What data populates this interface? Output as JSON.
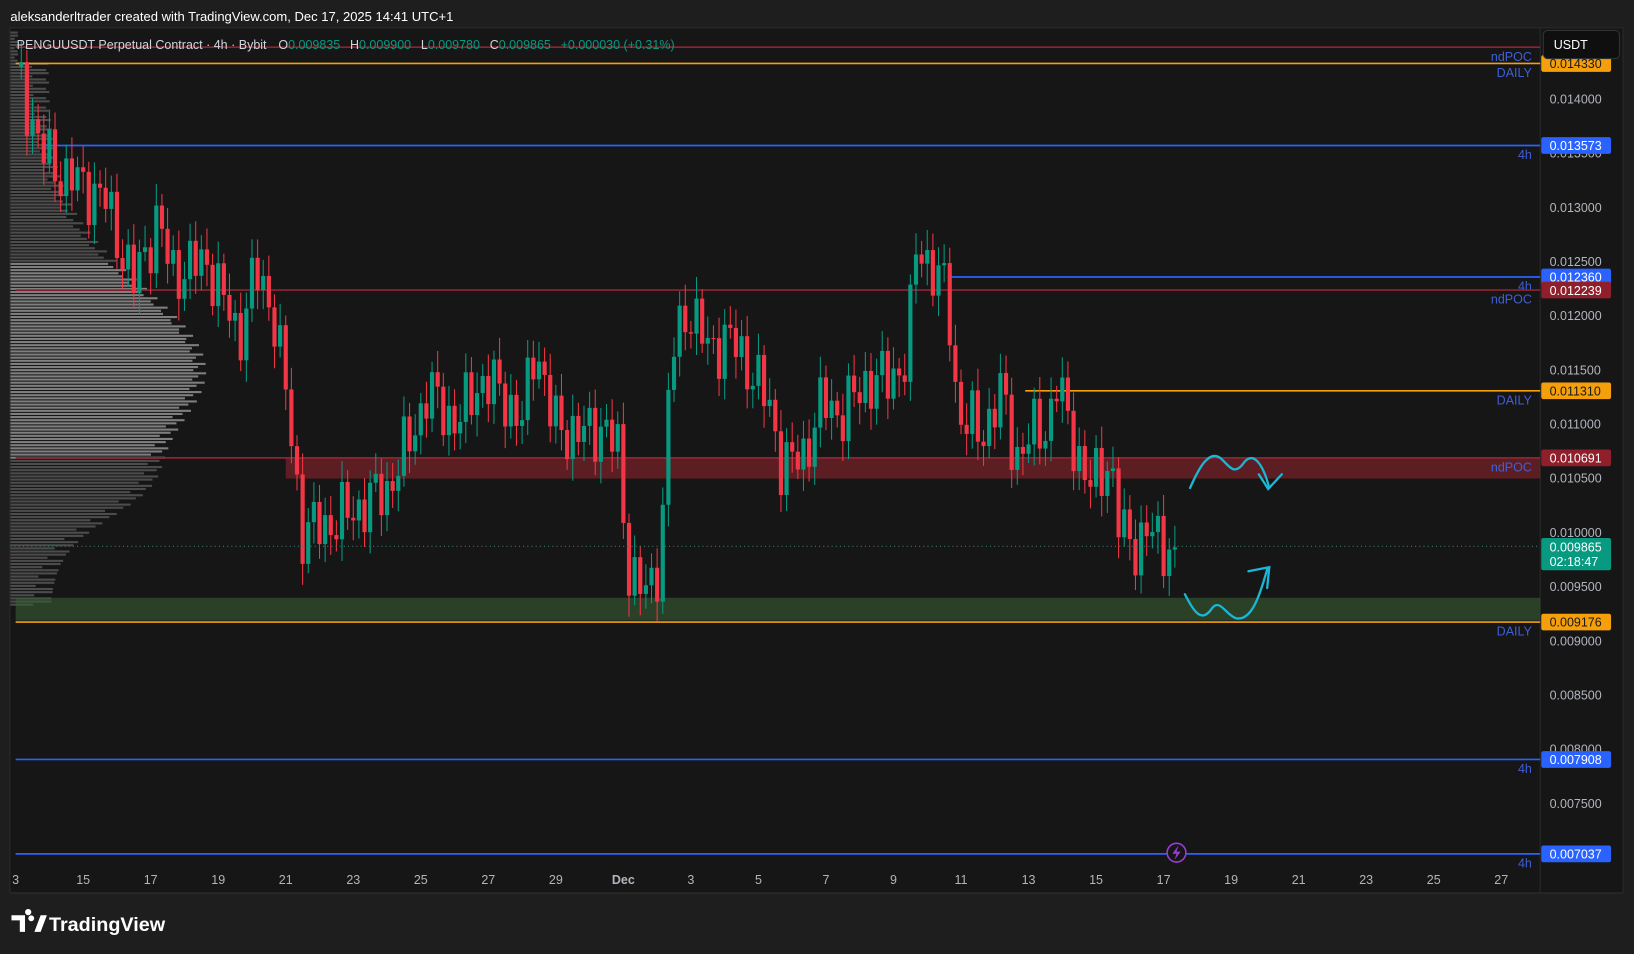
{
  "header": {
    "attribution": "aleksanderltrader created with TradingView.com, Dec 17, 2025 14:41 UTC+1",
    "symbol": "PENGUUSDT Perpetual Contract · 4h · Bybit",
    "o_label": "O",
    "o": "0.009835",
    "h_label": "H",
    "h": "0.009900",
    "l_label": "L",
    "l": "0.009780",
    "c_label": "C",
    "c": "0.009865",
    "change": "+0.000030 (+0.31%)"
  },
  "currency_button": "USDT",
  "price_axis_ticks": [
    "0.014000",
    "0.013500",
    "0.013000",
    "0.012500",
    "0.012000",
    "0.011500",
    "0.011000",
    "0.010500",
    "0.010000",
    "0.009500",
    "0.009000",
    "0.008500",
    "0.008000",
    "0.007500"
  ],
  "time_axis_ticks": [
    "3",
    "15",
    "17",
    "19",
    "21",
    "23",
    "25",
    "27",
    "29",
    "Dec",
    "3",
    "5",
    "7",
    "9",
    "11",
    "13",
    "15",
    "17",
    "19",
    "21",
    "23",
    "25",
    "27"
  ],
  "levels": [
    {
      "price": 0.01448,
      "color": "#8e2431",
      "label": "ndPOC",
      "tag": null,
      "start_day": 0
    },
    {
      "price": 0.01433,
      "color": "#f59f0b",
      "label": "DAILY",
      "tag": "0.014330",
      "start_day": 0
    },
    {
      "price": 0.013573,
      "color": "#2962ff",
      "label": "4h",
      "tag": "0.013573",
      "start_day": 0.8
    },
    {
      "price": 0.01236,
      "color": "#2962ff",
      "label": "4h",
      "tag": "0.012360",
      "start_day": 27.6
    },
    {
      "price": 0.012239,
      "color": "#8e2431",
      "label": "ndPOC",
      "tag": "0.012239",
      "start_day": 0
    },
    {
      "price": 0.01131,
      "color": "#f59f0b",
      "label": "DAILY",
      "tag": "0.011310",
      "start_day": 29.9
    },
    {
      "price": 0.010691,
      "color": "#8e2431",
      "label": "ndPOC",
      "tag": "0.010691",
      "start_day": 0
    },
    {
      "price": 0.009176,
      "color": "#f59f0b",
      "label": "DAILY",
      "tag": "0.009176",
      "start_day": 0
    },
    {
      "price": 0.007908,
      "color": "#2962ff",
      "label": "4h",
      "tag": "0.007908",
      "start_day": 0
    },
    {
      "price": 0.007037,
      "color": "#2962ff",
      "label": "4h",
      "tag": "0.007037",
      "start_day": 0
    }
  ],
  "zones": [
    {
      "name": "ndpoc-zone",
      "top": 0.010691,
      "bottom": 0.0105,
      "color": "rgba(178,40,51,0.45)",
      "start_day": 8.0
    },
    {
      "name": "demand-zone",
      "top": 0.0094,
      "bottom": 0.00919,
      "color": "rgba(56,95,52,0.6)",
      "start_day": 0
    }
  ],
  "current_price": {
    "value": "0.009865",
    "countdown": "02:18:47",
    "color": "#089981"
  },
  "colors": {
    "up": "#089981",
    "down": "#f23645",
    "annotation": "#1ab8d6"
  },
  "chart_data": {
    "type": "candlestick",
    "title": "PENGUUSDT Perpetual Contract · 4h · Bybit",
    "x_unit": "days since Nov 13, 2025",
    "ylim": [
      0.0069,
      0.0148
    ],
    "price_path": [
      [
        0,
        0.0143
      ],
      [
        0.8,
        0.0135
      ],
      [
        1.4,
        0.0133
      ],
      [
        2.6,
        0.0131
      ],
      [
        3.5,
        0.0123
      ],
      [
        4.2,
        0.0129
      ],
      [
        4.6,
        0.0124
      ],
      [
        5.7,
        0.0125
      ],
      [
        6.6,
        0.0118
      ],
      [
        7.1,
        0.0124
      ],
      [
        7.6,
        0.0121
      ],
      [
        8.0,
        0.0113
      ],
      [
        8.5,
        0.01
      ],
      [
        9.4,
        0.0101
      ],
      [
        10.0,
        0.0102
      ],
      [
        11.0,
        0.0104
      ],
      [
        11.6,
        0.0108
      ],
      [
        12.2,
        0.0113
      ],
      [
        13.1,
        0.011
      ],
      [
        13.7,
        0.0114
      ],
      [
        14.4,
        0.0113
      ],
      [
        15.0,
        0.011
      ],
      [
        15.4,
        0.0118
      ],
      [
        15.9,
        0.011
      ],
      [
        16.8,
        0.0109
      ],
      [
        17.4,
        0.011
      ],
      [
        17.9,
        0.0107
      ],
      [
        18.1,
        0.0097
      ],
      [
        18.7,
        0.0094
      ],
      [
        19.1,
        0.0098
      ],
      [
        19.4,
        0.0116
      ],
      [
        19.9,
        0.0121
      ],
      [
        20.5,
        0.0117
      ],
      [
        21.1,
        0.0118
      ],
      [
        21.8,
        0.0115
      ],
      [
        22.4,
        0.0111
      ],
      [
        22.7,
        0.0106
      ],
      [
        23.3,
        0.0107
      ],
      [
        23.9,
        0.0112
      ],
      [
        24.5,
        0.0111
      ],
      [
        25.2,
        0.0114
      ],
      [
        25.8,
        0.0114
      ],
      [
        26.4,
        0.0116
      ],
      [
        26.7,
        0.0127
      ],
      [
        27.2,
        0.0124
      ],
      [
        27.6,
        0.0122
      ],
      [
        27.9,
        0.0111
      ],
      [
        28.6,
        0.0109
      ],
      [
        29.2,
        0.0113
      ],
      [
        29.6,
        0.0107
      ],
      [
        30.1,
        0.0109
      ],
      [
        30.6,
        0.011
      ],
      [
        30.8,
        0.0114
      ],
      [
        31.2,
        0.011
      ],
      [
        31.8,
        0.0104
      ],
      [
        32.4,
        0.0107
      ],
      [
        32.7,
        0.01
      ],
      [
        33.2,
        0.0099
      ],
      [
        33.5,
        0.01
      ],
      [
        34.0,
        0.0099
      ],
      [
        34.35,
        0.009865
      ]
    ]
  },
  "footer": {
    "logo_text": "TradingView"
  }
}
